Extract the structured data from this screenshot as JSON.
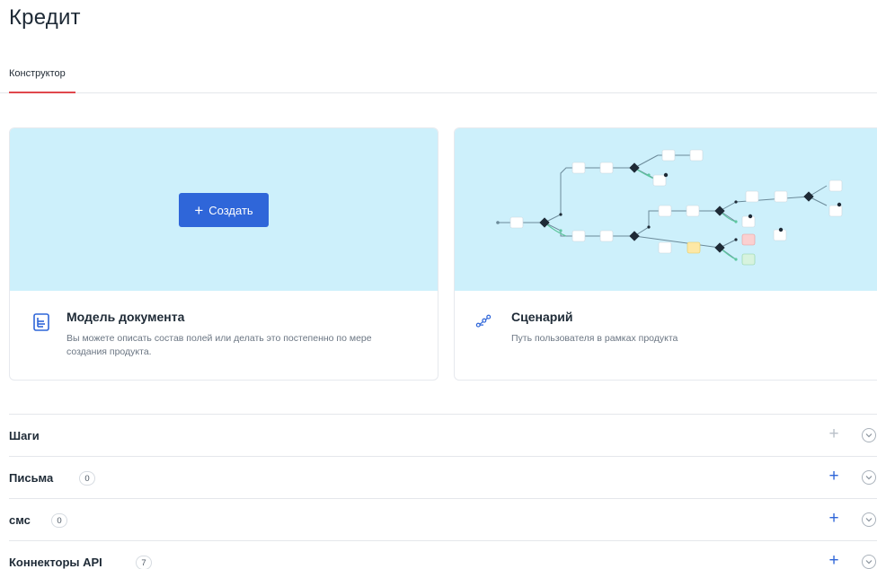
{
  "page": {
    "title": "Кредит"
  },
  "tabs": [
    {
      "label": "Конструктор",
      "active": true
    }
  ],
  "cards": {
    "document_model": {
      "title": "Модель документа",
      "description": "Вы можете описать состав полей или делать это постепенно по мере создания продукта.",
      "create_label": "Создать",
      "icon": "document-structure-icon",
      "hero_color": "#cdf0fb"
    },
    "scenario": {
      "title": "Сценарий",
      "description": "Путь пользователя в рамках продукта",
      "icon": "flow-path-icon"
    }
  },
  "sections": [
    {
      "title": "Шаги",
      "count": null,
      "add_enabled": false
    },
    {
      "title": "Письма",
      "count": "0",
      "add_enabled": true
    },
    {
      "title": "смс",
      "count": "0",
      "add_enabled": true
    },
    {
      "title": "Коннекторы API",
      "count": "7",
      "add_enabled": true
    }
  ],
  "colors": {
    "accent": "#2f66d9",
    "tab_underline": "#e0474c",
    "hero_background": "#cdf0fb"
  }
}
